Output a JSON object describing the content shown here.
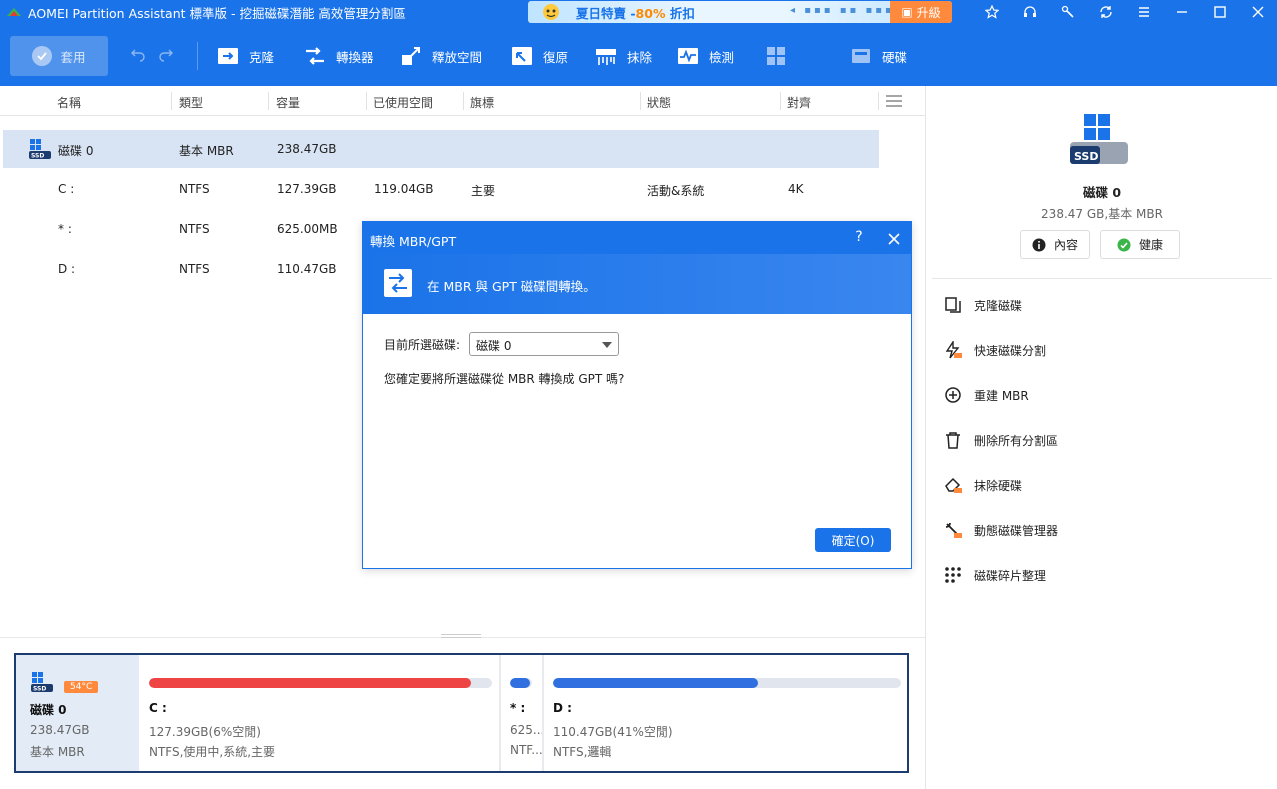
{
  "window": {
    "title": "AOMEI Partition Assistant 標準版 - 挖掘磁碟潛能 高效管理分割區",
    "promo_text": "夏日特賣 -",
    "promo_pct": "80%",
    "promo_suffix": " 折扣",
    "upgrade_label": "升級"
  },
  "toolbar": {
    "apply_label": "套用",
    "tools": [
      {
        "label": "克隆",
        "icon": "clone-icon"
      },
      {
        "label": "轉換器",
        "icon": "convert-icon"
      },
      {
        "label": "釋放空間",
        "icon": "free-space-icon"
      },
      {
        "label": "復原",
        "icon": "recover-icon"
      },
      {
        "label": "抹除",
        "icon": "wipe-icon"
      },
      {
        "label": "檢測",
        "icon": "check-icon"
      },
      {
        "label": "",
        "icon": "more-icon"
      },
      {
        "label": "硬碟",
        "icon": "disk-tool-icon"
      }
    ]
  },
  "table": {
    "columns": [
      "名稱",
      "類型",
      "容量",
      "已使用空間",
      "旗標",
      "狀態",
      "對齊"
    ],
    "rows": [
      {
        "name": "磁碟 0",
        "type": "基本 MBR",
        "capacity": "238.47GB",
        "used": "",
        "flag": "",
        "status": "",
        "align": ""
      },
      {
        "name": "C :",
        "type": "NTFS",
        "capacity": "127.39GB",
        "used": "119.04GB",
        "flag": "主要",
        "status": "活動&系統",
        "align": "4K"
      },
      {
        "name": "* :",
        "type": "NTFS",
        "capacity": "625.00MB",
        "used": "",
        "flag": "",
        "status": "",
        "align": ""
      },
      {
        "name": "D :",
        "type": "NTFS",
        "capacity": "110.47GB",
        "used": "",
        "flag": "",
        "status": "",
        "align": ""
      }
    ]
  },
  "dialog": {
    "title": "轉換 MBR/GPT",
    "help": "?",
    "subtitle": "在 MBR 與 GPT 磁碟間轉換。",
    "select_label": "目前所選磁碟:",
    "select_value": "磁碟 0",
    "question": "您確定要將所選磁碟從 MBR 轉換成 GPT 嗎?",
    "ok_label": "確定(O)"
  },
  "diskmap": {
    "disk_name": "磁碟 0",
    "disk_size": "238.47GB",
    "disk_type": "基本 MBR",
    "temperature": "54°C",
    "partitions": [
      {
        "name": "C :",
        "line1": "127.39GB(6%空閒)",
        "line2": "NTFS,使用中,系統,主要",
        "used_fraction": 0.94,
        "color": "#ef4444"
      },
      {
        "name": "* :",
        "line1": "625...",
        "line2": "NTF...",
        "used_fraction": 0.9,
        "color": "#2f6fe0"
      },
      {
        "name": "D :",
        "line1": "110.47GB(41%空閒)",
        "line2": "NTFS,邏輯",
        "used_fraction": 0.59,
        "color": "#2f6fe0"
      }
    ]
  },
  "right_panel": {
    "disk_name": "磁碟 0",
    "disk_info": "238.47 GB,基本 MBR",
    "btn_props": "內容",
    "btn_health": "健康",
    "actions": [
      "克隆磁碟",
      "快速磁碟分割",
      "重建 MBR",
      "刪除所有分割區",
      "抹除硬碟",
      "動態磁碟管理器",
      "磁碟碎片整理"
    ]
  },
  "colors": {
    "accent": "#1a73e8",
    "partition_c": "#ef4444",
    "partition_d": "#2f6fe0",
    "badge": "#ff8a3d"
  }
}
